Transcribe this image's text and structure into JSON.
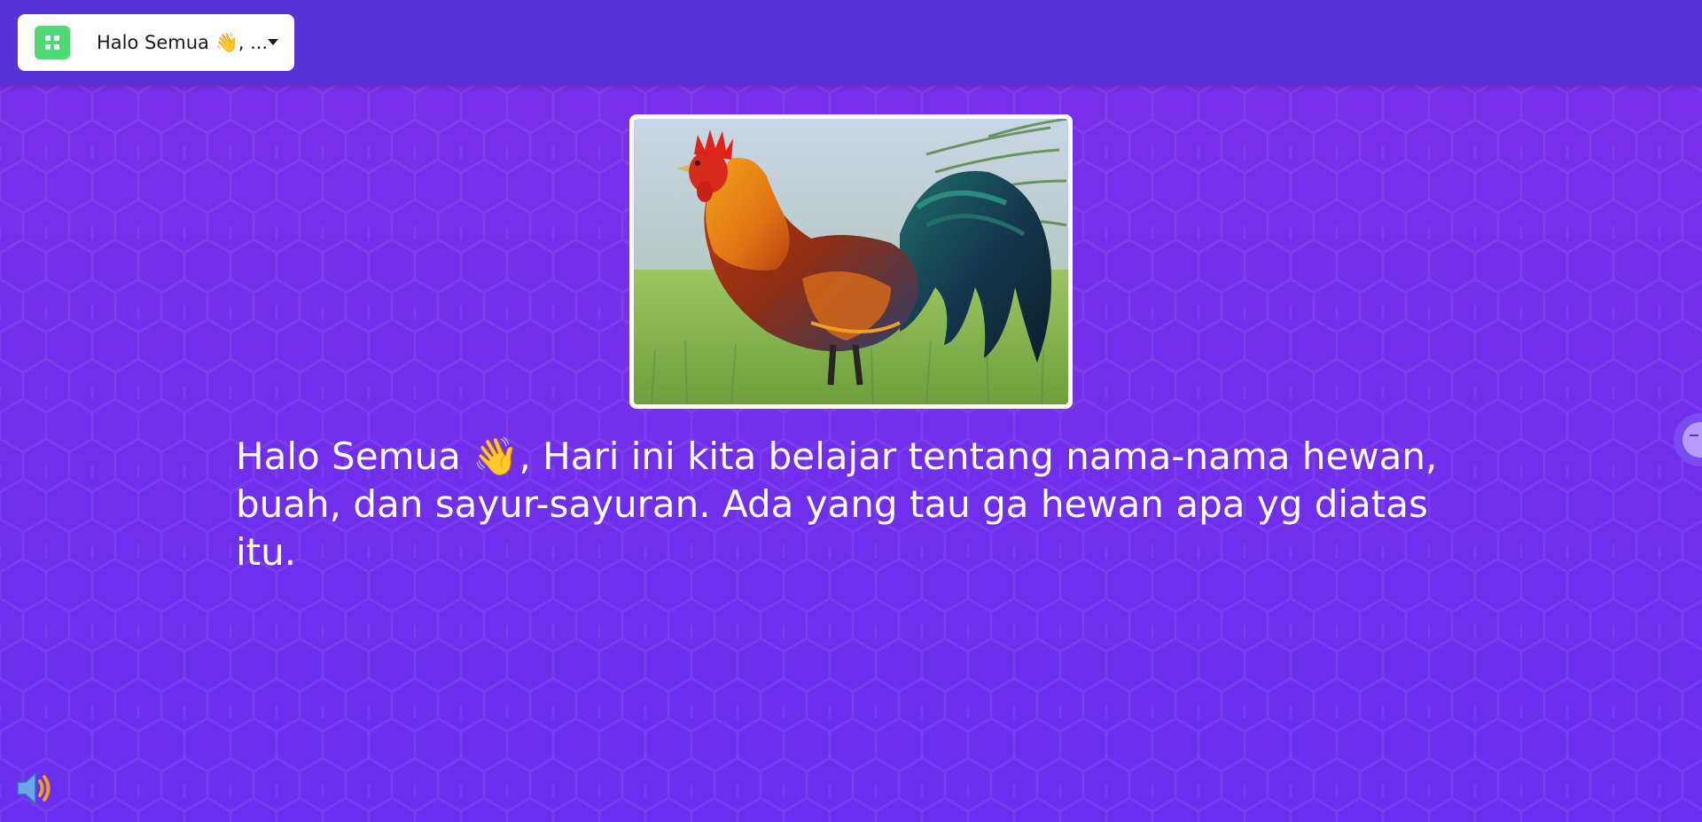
{
  "header": {
    "selector_label": "Halo Semua 👋, ...",
    "app_icon": "grid-icon",
    "caret_icon": "caret-down-icon"
  },
  "slide": {
    "image_alt": "rooster",
    "text": "Halo Semua 👋, Hari ini kita belajar tentang nama-nama hewan, buah, dan sayur-sayuran. Ada yang tau ga hewan apa yg diatas itu."
  },
  "controls": {
    "sound_icon": "speaker-icon",
    "side_handle_icon": "arrow-icon"
  },
  "colors": {
    "background": "#6b2fe6",
    "topbar": "#5533d4",
    "app_icon": "#4fd876",
    "text": "#ffffff"
  }
}
